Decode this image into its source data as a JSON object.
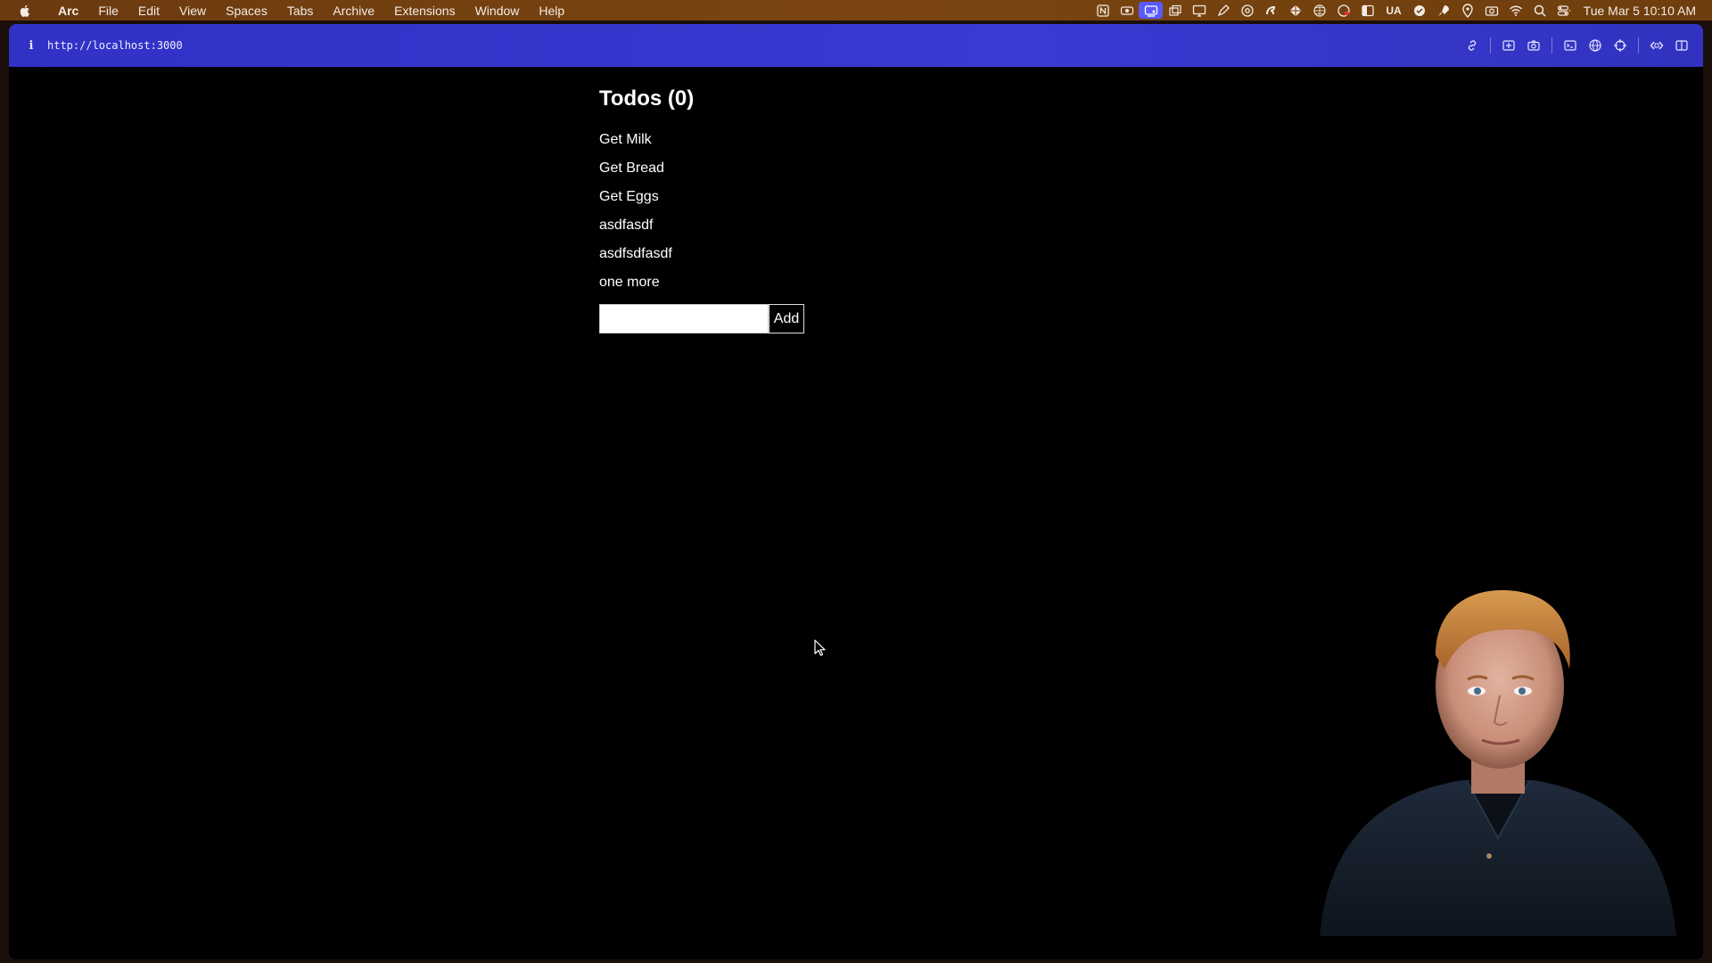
{
  "menubar": {
    "app_name": "Arc",
    "items": [
      "File",
      "Edit",
      "View",
      "Spaces",
      "Tabs",
      "Archive",
      "Extensions",
      "Window",
      "Help"
    ],
    "tray_text": "UA",
    "clock": "Tue Mar 5  10:10 AM",
    "active_color": "#5a5aff"
  },
  "browser": {
    "url": "http://localhost:3000",
    "accent": "#3434cc"
  },
  "app": {
    "title": "Todos (0)",
    "todos": [
      "Get Milk",
      "Get Bread",
      "Get Eggs",
      "asdfasdf",
      "asdfsdfasdf",
      "one more"
    ],
    "input_value": "",
    "add_label": "Add"
  }
}
